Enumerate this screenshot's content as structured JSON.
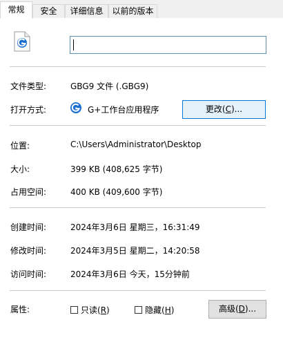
{
  "tabs": [
    {
      "label": "常规",
      "active": true
    },
    {
      "label": "安全",
      "active": false
    },
    {
      "label": "详细信息",
      "active": false
    },
    {
      "label": "以前的版本",
      "active": false
    }
  ],
  "file": {
    "icon": "g-plus-file-icon",
    "name_value": ""
  },
  "props": {
    "type_label": "文件类型:",
    "type_value": "GBG9 文件 (.GBG9)",
    "open_label": "打开方式:",
    "open_app_icon": "g-plus-app-icon",
    "open_value": "G+工作台应用程序",
    "change_button": {
      "prefix": "更改(",
      "hotkey": "C",
      "suffix": ")..."
    },
    "location_label": "位置:",
    "location_value": "C:\\Users\\Administrator\\Desktop",
    "size_label": "大小:",
    "size_value": "399 KB (408,625 字节)",
    "disk_label": "占用空间:",
    "disk_value": "400 KB (409,600 字节)",
    "created_label": "创建时间:",
    "created_value": "2024年3月6日 星期三，16:31:49",
    "modified_label": "修改时间:",
    "modified_value": "2024年3月5日 星期二，14:20:58",
    "accessed_label": "访问时间:",
    "accessed_value": "2024年3月6日 今天，15分钟前",
    "attr_label": "属性:",
    "readonly": {
      "prefix": "只读(",
      "hotkey": "R",
      "suffix": ")",
      "checked": false
    },
    "hidden": {
      "prefix": "隐藏(",
      "hotkey": "H",
      "suffix": ")",
      "checked": false
    },
    "advanced_button": {
      "prefix": "高级(",
      "hotkey": "D",
      "suffix": ")..."
    }
  },
  "colors": {
    "accent": "#0078d7",
    "icon_blue": "#1a6fd1",
    "separator": "#c8c8c8"
  }
}
